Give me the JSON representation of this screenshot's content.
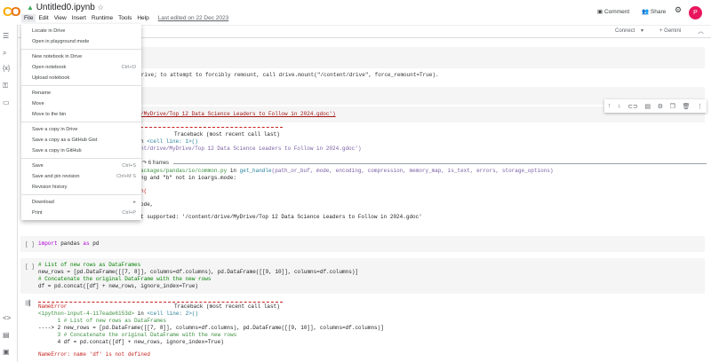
{
  "header": {
    "logo": "CO",
    "title": "Untitled0.ipynb",
    "menus": [
      "File",
      "Edit",
      "View",
      "Insert",
      "Runtime",
      "Tools",
      "Help"
    ],
    "last_edited": "Last edited on 22 Dec 2023",
    "comment": "Comment",
    "share": "Share",
    "avatar": "P"
  },
  "toolbar": {
    "connect": "Connect",
    "gemini": "Gemini"
  },
  "file_menu": [
    {
      "label": "Locate in Drive",
      "shortcut": ""
    },
    {
      "label": "Open in playground mode",
      "shortcut": ""
    },
    {
      "label": "New notebook in Drive",
      "shortcut": ""
    },
    {
      "label": "Open notebook",
      "shortcut": "Ctrl+O"
    },
    {
      "label": "Upload notebook",
      "shortcut": ""
    },
    {
      "label": "Rename",
      "shortcut": ""
    },
    {
      "label": "Move",
      "shortcut": ""
    },
    {
      "label": "Move to the bin",
      "shortcut": ""
    },
    {
      "label": "Save a copy in Drive",
      "shortcut": ""
    },
    {
      "label": "Save a copy as a GitHub Gist",
      "shortcut": ""
    },
    {
      "label": "Save a copy in GitHub",
      "shortcut": ""
    },
    {
      "label": "Save",
      "shortcut": "Ctrl+S"
    },
    {
      "label": "Save and pin revision",
      "shortcut": "Ctrl+M S"
    },
    {
      "label": "Revision history",
      "shortcut": ""
    },
    {
      "label": "Download",
      "shortcut": "▸"
    },
    {
      "label": "Print",
      "shortcut": "Ctrl+P"
    }
  ],
  "cells": {
    "out1": "t/drive; to attempt to forcibly remount, call drive.mount(\"/content/drive\", force_remount=True).",
    "code3": "/MyDrive/Top 12 Data Science Leaders to Follow in 2024.gdoc')",
    "tb1": "Traceback (most recent call last)",
    "tb2a": "n ",
    "tb2b": "<cell line: 1>()",
    "tb3": "nt/drive/MyDrive/Top 12 Data Science Leaders to Follow in 2024.gdoc')",
    "frames": "6 frames",
    "tb4a": "ackages/pandas/io/common.py",
    "tb4b": " in ",
    "tb4c": "get_handle",
    "tb4d": "(path_or_buf, mode, encoding, compression, memory_map, is_text, errors, storage_options)",
    "tb5": "ng and \"b\" not in ioargs.mode:",
    "tb6": "n(",
    "tb7": "ode,",
    "tb8": "t supported: '/content/drive/MyDrive/Top 12 Data Science Leaders to Follow in 2024.gdoc'",
    "run_label": "[ ]",
    "import_code": "import pandas as pd",
    "c5l1": "# List of new rows as DataFrames",
    "c5l2": "new_rows = [pd.DataFrame([[7, 8]], columns=df.columns), pd.DataFrame([[9, 10]], columns=df.columns)]",
    "c5l3": "# Concatenate the original DataFrame with the new rows",
    "c5l4": "df = pd.concat([df] + new_rows, ignore_index=True)",
    "e1a": "NameError",
    "e1b": "Traceback (most recent call last)",
    "e2a": "<ipython-input-4-117eade6153d>",
    "e2b": " in ",
    "e2c": "<cell line: 2>()",
    "e3": "      1 # List of new rows as DataFrames",
    "e4": "----> 2 new_rows = [pd.DataFrame([[7, 8]], columns=df.columns), pd.DataFrame([[9, 10]], columns=df.columns)]",
    "e5": "      3 # Concatenate the original DataFrame with the new rows",
    "e6": "      4 df = pd.concat([df] + new_rows, ignore_index=True)",
    "e7": "NameError: name 'df' is not defined"
  }
}
